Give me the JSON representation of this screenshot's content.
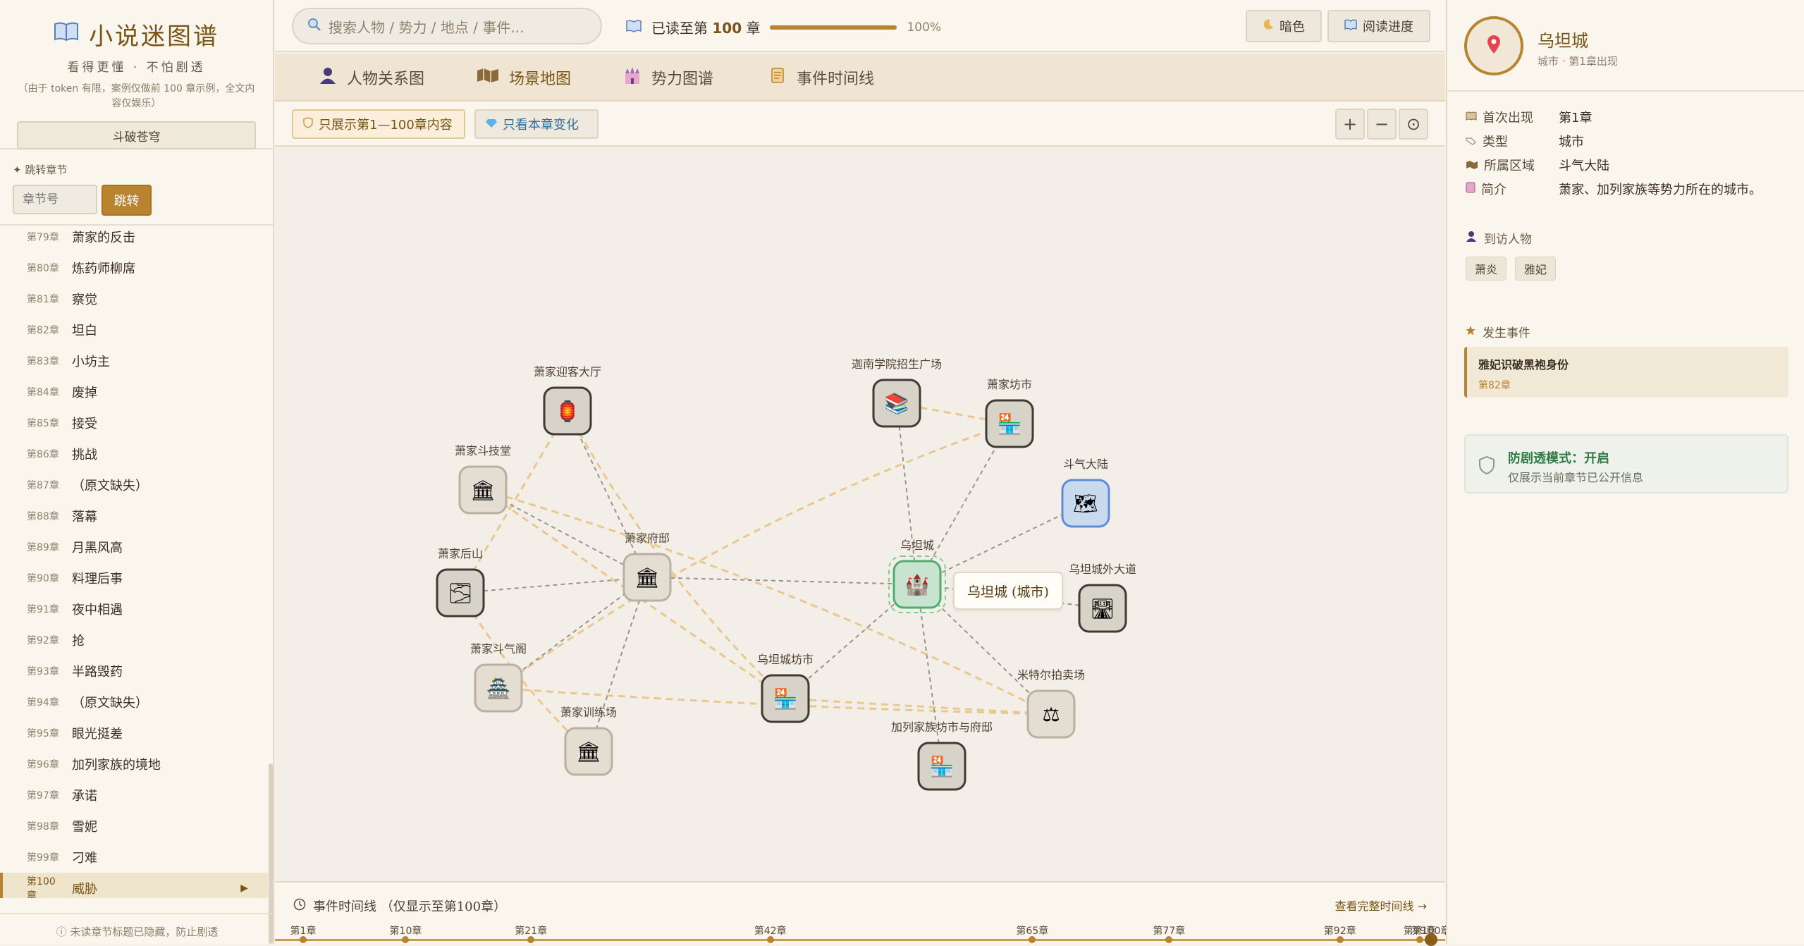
{
  "brand": {
    "title": "小说迷图谱",
    "tagline": "看得更懂 · 不怕剧透",
    "note": "（由于 token 有限，案例仅做前 100 章示例，全文内容仅娱乐）",
    "book": "斗破苍穹"
  },
  "jump": {
    "title": "✦ 跳转章节",
    "placeholder": "章节号",
    "button": "跳转"
  },
  "chapters": [
    {
      "no": "第79章",
      "title": "萧家的反击"
    },
    {
      "no": "第80章",
      "title": "炼药师柳席"
    },
    {
      "no": "第81章",
      "title": "察觉"
    },
    {
      "no": "第82章",
      "title": "坦白"
    },
    {
      "no": "第83章",
      "title": "小坊主"
    },
    {
      "no": "第84章",
      "title": "废掉"
    },
    {
      "no": "第85章",
      "title": "接受"
    },
    {
      "no": "第86章",
      "title": "挑战"
    },
    {
      "no": "第87章",
      "title": "（原文缺失）"
    },
    {
      "no": "第88章",
      "title": "落幕"
    },
    {
      "no": "第89章",
      "title": "月黑风高"
    },
    {
      "no": "第90章",
      "title": "料理后事"
    },
    {
      "no": "第91章",
      "title": "夜中相遇"
    },
    {
      "no": "第92章",
      "title": "抢"
    },
    {
      "no": "第93章",
      "title": "半路毁药"
    },
    {
      "no": "第94章",
      "title": "（原文缺失）"
    },
    {
      "no": "第95章",
      "title": "眼光挺差"
    },
    {
      "no": "第96章",
      "title": "加列家族的境地"
    },
    {
      "no": "第97章",
      "title": "承诺"
    },
    {
      "no": "第98章",
      "title": "雪妮"
    },
    {
      "no": "第99章",
      "title": "刁难"
    },
    {
      "no": "第100章",
      "title": "威胁",
      "active": true
    }
  ],
  "sidebar_footer": "ⓘ 未读章节标题已隐藏，防止剧透",
  "search": {
    "placeholder": "搜索人物 / 势力 / 地点 / 事件..."
  },
  "progress": {
    "prefix": "已读至第",
    "chapter": "100",
    "suffix": "章",
    "percent_label": "100%",
    "fraction": 1.0
  },
  "top_buttons": {
    "dark": "暗色",
    "reading": "阅读进度"
  },
  "tabs": [
    {
      "label": "人物关系图",
      "icon": "person-icon"
    },
    {
      "label": "场景地图",
      "icon": "map-icon",
      "active": true
    },
    {
      "label": "势力图谱",
      "icon": "castle-icon"
    },
    {
      "label": "事件时间线",
      "icon": "scroll-icon"
    }
  ],
  "filters": {
    "range": "只展示第1—100章内容",
    "changes": "只看本章变化"
  },
  "zoom": {
    "in": "+",
    "out": "−",
    "reset": "⊙"
  },
  "map": {
    "nodes": [
      {
        "id": "yingke",
        "label": "萧家迎客大厅",
        "emoji": "🏮",
        "style": "gray"
      },
      {
        "id": "dou",
        "label": "萧家斗技堂",
        "emoji": "🏛",
        "style": "light"
      },
      {
        "id": "houshan",
        "label": "萧家后山",
        "emoji": "🌫",
        "style": "gray"
      },
      {
        "id": "fudi",
        "label": "萧家府邸",
        "emoji": "🏛",
        "style": "light"
      },
      {
        "id": "douqi",
        "label": "萧家斗气阁",
        "emoji": "🏯",
        "style": "light"
      },
      {
        "id": "xunlian",
        "label": "萧家训练场",
        "emoji": "🏛",
        "style": "light"
      },
      {
        "id": "jianan",
        "label": "迦南学院招生广场",
        "emoji": "📚",
        "style": "gray"
      },
      {
        "id": "fangshi",
        "label": "萧家坊市",
        "emoji": "🏪",
        "style": "gray"
      },
      {
        "id": "dalu",
        "label": "斗气大陆",
        "emoji": "🗺",
        "style": "blue"
      },
      {
        "id": "wutan",
        "label": "乌坦城",
        "emoji": "🏰",
        "style": "green"
      },
      {
        "id": "waidao",
        "label": "乌坦城外大道",
        "emoji": "🛣",
        "style": "gray"
      },
      {
        "id": "wtfangshi",
        "label": "乌坦城坊市",
        "emoji": "🏪",
        "style": "gray"
      },
      {
        "id": "paimai",
        "label": "米特尔拍卖场",
        "emoji": "⚖",
        "style": "light"
      },
      {
        "id": "jialie",
        "label": "加列家族坊市与府邸",
        "emoji": "🏪",
        "style": "gray"
      }
    ],
    "tooltip": "乌坦城 (城市)"
  },
  "timeline": {
    "title": "事件时间线 （仅显示至第100章）",
    "link": "查看完整时间线 →",
    "ticks": [
      {
        "label": "第1章",
        "ch": 1
      },
      {
        "label": "第10章",
        "ch": 10
      },
      {
        "label": "第21章",
        "ch": 21
      },
      {
        "label": "第42章",
        "ch": 42
      },
      {
        "label": "第65章",
        "ch": 65
      },
      {
        "label": "第77章",
        "ch": 77
      },
      {
        "label": "第92章",
        "ch": 92
      },
      {
        "label": "第99章",
        "ch": 99
      },
      {
        "label": "第100章",
        "ch": 100
      }
    ]
  },
  "panel": {
    "name": "乌坦城",
    "subtitle": "城市 · 第1章出现",
    "info": [
      {
        "key": "首次出现",
        "value": "第1章",
        "icon": "book-icon"
      },
      {
        "key": "类型",
        "value": "城市",
        "icon": "tag-icon"
      },
      {
        "key": "所属区域",
        "value": "斗气大陆",
        "icon": "map-icon"
      },
      {
        "key": "简介",
        "value": "萧家、加列家族等势力所在的城市。",
        "icon": "note-icon"
      }
    ],
    "visitors_title": "到访人物",
    "visitors": [
      "萧炎",
      "雅妃"
    ],
    "events_title": "发生事件",
    "event": {
      "title": "雅妃识破黑袍身份",
      "chapter": "第82章"
    },
    "spoiler": {
      "title": "防剧透模式：开启",
      "desc": "仅展示当前章节已公开信息"
    }
  },
  "colors": {
    "accent": "#b8842f",
    "accent_dark": "#7a5416",
    "green": "#2f7a45",
    "blue_node": "#5b8ed6"
  }
}
